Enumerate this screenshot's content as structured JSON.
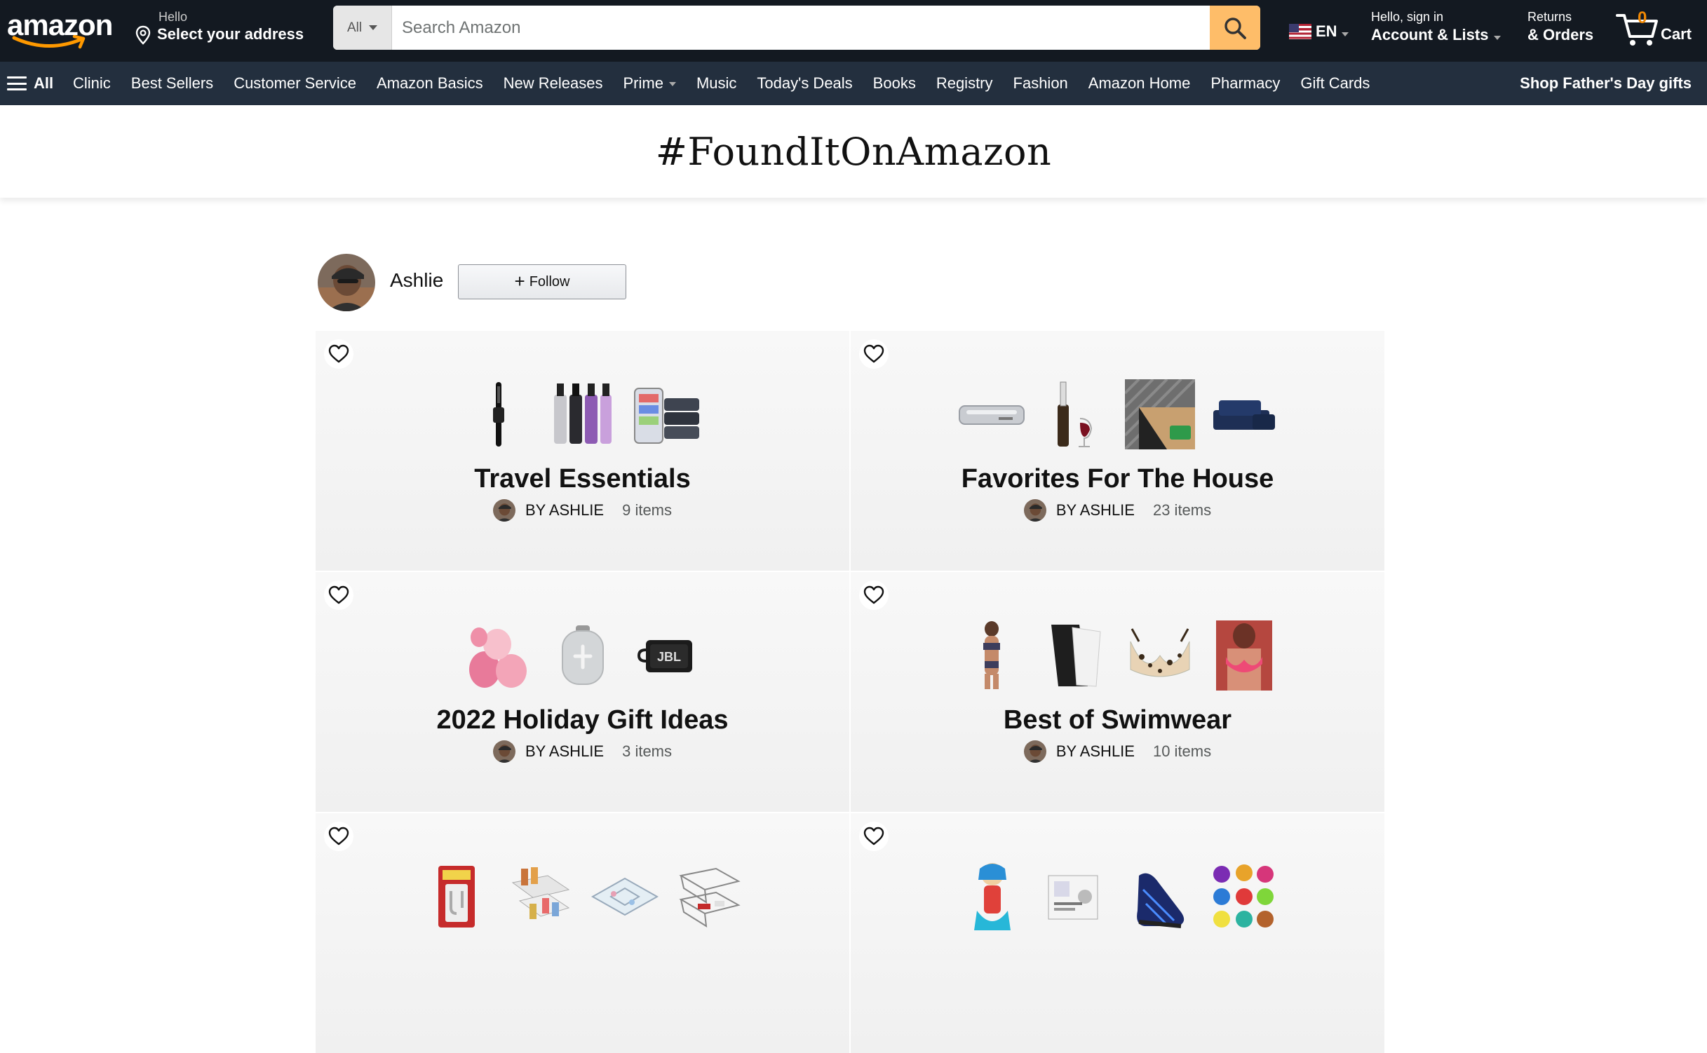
{
  "header": {
    "logo_text": "amazon",
    "deliver_line1": "Hello",
    "deliver_line2": "Select your address",
    "search_dept": "All",
    "search_placeholder": "Search Amazon",
    "lang": "EN",
    "account_line1": "Hello, sign in",
    "account_line2": "Account & Lists",
    "returns_line1": "Returns",
    "returns_line2": "& Orders",
    "cart_count": "0",
    "cart_label": "Cart"
  },
  "subnav": {
    "all_label": "All",
    "links": [
      "Clinic",
      "Best Sellers",
      "Customer Service",
      "Amazon Basics",
      "New Releases",
      "Prime",
      "Music",
      "Today's Deals",
      "Books",
      "Registry",
      "Fashion",
      "Amazon Home",
      "Pharmacy",
      "Gift Cards"
    ],
    "promo": "Shop Father's Day gifts"
  },
  "page_title": "#FoundItOnAmazon",
  "profile": {
    "name": "Ashlie",
    "follow_label": "Follow"
  },
  "colors": {
    "nav_dark": "#131921",
    "nav_sub": "#232f3e",
    "search_button": "#febd69",
    "cart_count": "#f08804"
  },
  "lists": [
    {
      "title": "Travel Essentials",
      "by": "BY ASHLIE",
      "items": "9 items",
      "thumbs": [
        "curling-iron",
        "perfume-atomizers",
        "packing-cubes"
      ]
    },
    {
      "title": "Favorites For The House",
      "by": "BY ASHLIE",
      "items": "23 items",
      "thumbs": [
        "vacuum-sealer",
        "wine-aerator",
        "rug-gripper",
        "navy-sheets"
      ]
    },
    {
      "title": "2022 Holiday Gift Ideas",
      "by": "BY ASHLIE",
      "items": "3 items",
      "thumbs": [
        "makeup-sponges",
        "speaker",
        "jbl-speaker"
      ]
    },
    {
      "title": "Best of Swimwear",
      "by": "BY ASHLIE",
      "items": "10 items",
      "thumbs": [
        "bikini",
        "sarong",
        "leopard-top",
        "pink-bikini"
      ]
    },
    {
      "title": "",
      "by": "",
      "items": "",
      "thumbs": [
        "command-hooks",
        "organizer-bins",
        "clear-organizers",
        "wire-baskets"
      ]
    },
    {
      "title": "",
      "by": "",
      "items": "",
      "thumbs": [
        "costume",
        "glitter-box",
        "sneaker",
        "scrunchies"
      ]
    }
  ]
}
